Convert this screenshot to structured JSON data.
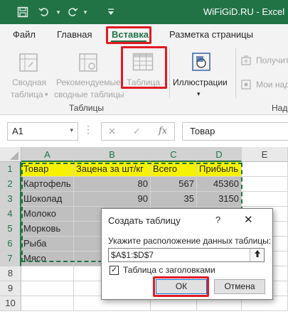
{
  "titlebar": {
    "title": "WiFiGiD.RU  -  Excel",
    "icons": [
      "save-icon",
      "undo-icon",
      "redo-icon",
      "customize-qat-icon"
    ]
  },
  "tabs": [
    {
      "label": "Файл",
      "active": false
    },
    {
      "label": "Главная",
      "active": false
    },
    {
      "label": "Вставка",
      "active": true
    },
    {
      "label": "Разметка страницы",
      "active": false
    }
  ],
  "ribbon": {
    "pivot_label_1": "Сводная",
    "pivot_label_2": "таблица",
    "recommended_label_1": "Рекомендуемые",
    "recommended_label_2": "сводные таблицы",
    "table_label": "Таблица",
    "illustrations_label": "Иллюстрации",
    "addins_get_label": "Получит",
    "addins_my_label": "Мои над",
    "group_tables": "Таблицы",
    "group_addins": "Надс"
  },
  "formula_bar": {
    "name_box": "A1",
    "cancel_symbol": "✕",
    "enter_symbol": "✓",
    "fx_symbol": "fx",
    "formula": "Товар"
  },
  "grid": {
    "columns": [
      "A",
      "B",
      "C",
      "D",
      "E"
    ],
    "rows": [
      "1",
      "2",
      "3",
      "4",
      "5",
      "6",
      "7",
      "8",
      "9",
      "10"
    ],
    "header_row": [
      "Товар",
      "Зацена за шт/кг",
      "Всего",
      "Прибыль"
    ],
    "data": [
      [
        "Картофель",
        "80",
        "567",
        "45360"
      ],
      [
        "Шоколад",
        "90",
        "35",
        "3150"
      ],
      [
        "Молоко",
        "",
        "",
        ""
      ],
      [
        "Морковь",
        "",
        "",
        ""
      ],
      [
        "Рыба",
        "",
        "",
        ""
      ],
      [
        "Мясо",
        "",
        "",
        ""
      ]
    ]
  },
  "dialog": {
    "title": "Создать таблицу",
    "help": "?",
    "close": "✕",
    "prompt": "Укажите расположение данных таблицы:",
    "range_value": "$A$1:$D$7",
    "checkbox_label": "Таблица с заголовками",
    "checkbox_checked": true,
    "ok_label": "ОК",
    "cancel_label": "Отмена"
  },
  "colors": {
    "excel_green": "#217346",
    "highlight_red": "#e01b24",
    "header_yellow": "#f7f300",
    "data_gray": "#bfbfbf"
  }
}
